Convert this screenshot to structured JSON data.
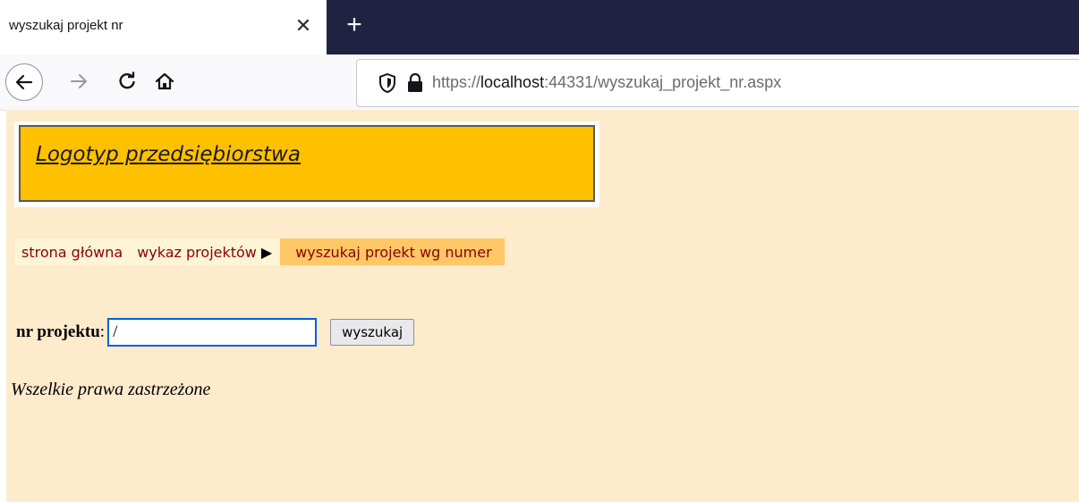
{
  "browser": {
    "tab_title": "wyszukaj projekt nr",
    "tab_close": "✕",
    "new_tab": "+",
    "url_scheme": "https://",
    "url_host": "localhost",
    "url_rest": ":44331/wyszukaj_projekt_nr.aspx",
    "icons": [
      "back-arrow-icon",
      "forward-arrow-icon",
      "reload-icon",
      "home-icon",
      "shield-icon",
      "lock-icon"
    ]
  },
  "page": {
    "logo_text": "Logotyp przedsiębiorstwa",
    "breadcrumb": {
      "home": "strona główna",
      "list": "wykaz projektów",
      "arrow": "▶",
      "current": "wyszukaj projekt wg numer"
    },
    "search": {
      "label": "nr projektu",
      "colon": ":",
      "value": "/",
      "button": "wyszukaj"
    },
    "footer": "Wszelkie prawa zastrzeżone"
  },
  "colors": {
    "page_bg": "#fdebcc",
    "logo_bg": "#ffc000",
    "breadcrumb_text": "#8b0000",
    "breadcrumb_current_bg": "#ffc766",
    "tabbar_bg": "#1f2341"
  }
}
